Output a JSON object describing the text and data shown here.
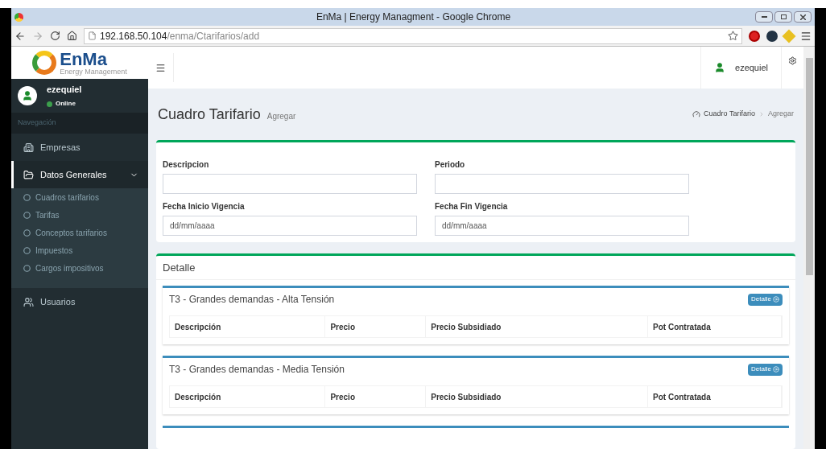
{
  "window": {
    "title": "EnMa | Energy Managment - Google Chrome"
  },
  "browser": {
    "url_host": "192.168.50.104",
    "url_path": "/enma/Ctarifarios/add"
  },
  "logo": {
    "name": "EnMa",
    "tagline": "Energy Management"
  },
  "user": {
    "name": "ezequiel",
    "status": "Online"
  },
  "header_user": "ezequiel",
  "sidebar": {
    "heading": "Navegación",
    "items": [
      {
        "label": "Empresas",
        "selected": false,
        "expanded": false
      },
      {
        "label": "Datos Generales",
        "selected": true,
        "expanded": true,
        "children": [
          {
            "label": "Cuadros tarifarios"
          },
          {
            "label": "Tarifas"
          },
          {
            "label": "Conceptos tarifarios"
          },
          {
            "label": "Impuestos"
          },
          {
            "label": "Cargos impositivos"
          }
        ]
      },
      {
        "label": "Usuarios",
        "selected": false,
        "expanded": false
      }
    ]
  },
  "page": {
    "title": "Cuadro Tarifario",
    "subtitle": "Agregar",
    "breadcrumb": [
      "Cuadro Tarifario",
      "Agregar"
    ]
  },
  "form": {
    "fields": [
      {
        "label": "Descripcion"
      },
      {
        "label": "Periodo"
      },
      {
        "label": "Fecha Inicio Vigencia",
        "placeholder": "dd/mm/aaaa"
      },
      {
        "label": "Fecha Fin Vigencia",
        "placeholder": "dd/mm/aaaa"
      }
    ]
  },
  "detail": {
    "title": "Detalle",
    "panels": [
      {
        "title": "T3 - Grandes demandas - Alta Tensión",
        "button": "Detalle",
        "columns": [
          "Descripción",
          "Precio",
          "Precio Subsidiado",
          "Pot Contratada"
        ]
      },
      {
        "title": "T3 - Grandes demandas - Media Tensión",
        "button": "Detalle",
        "columns": [
          "Descripción",
          "Precio",
          "Precio Subsidiado",
          "Pot Contratada"
        ]
      }
    ]
  }
}
